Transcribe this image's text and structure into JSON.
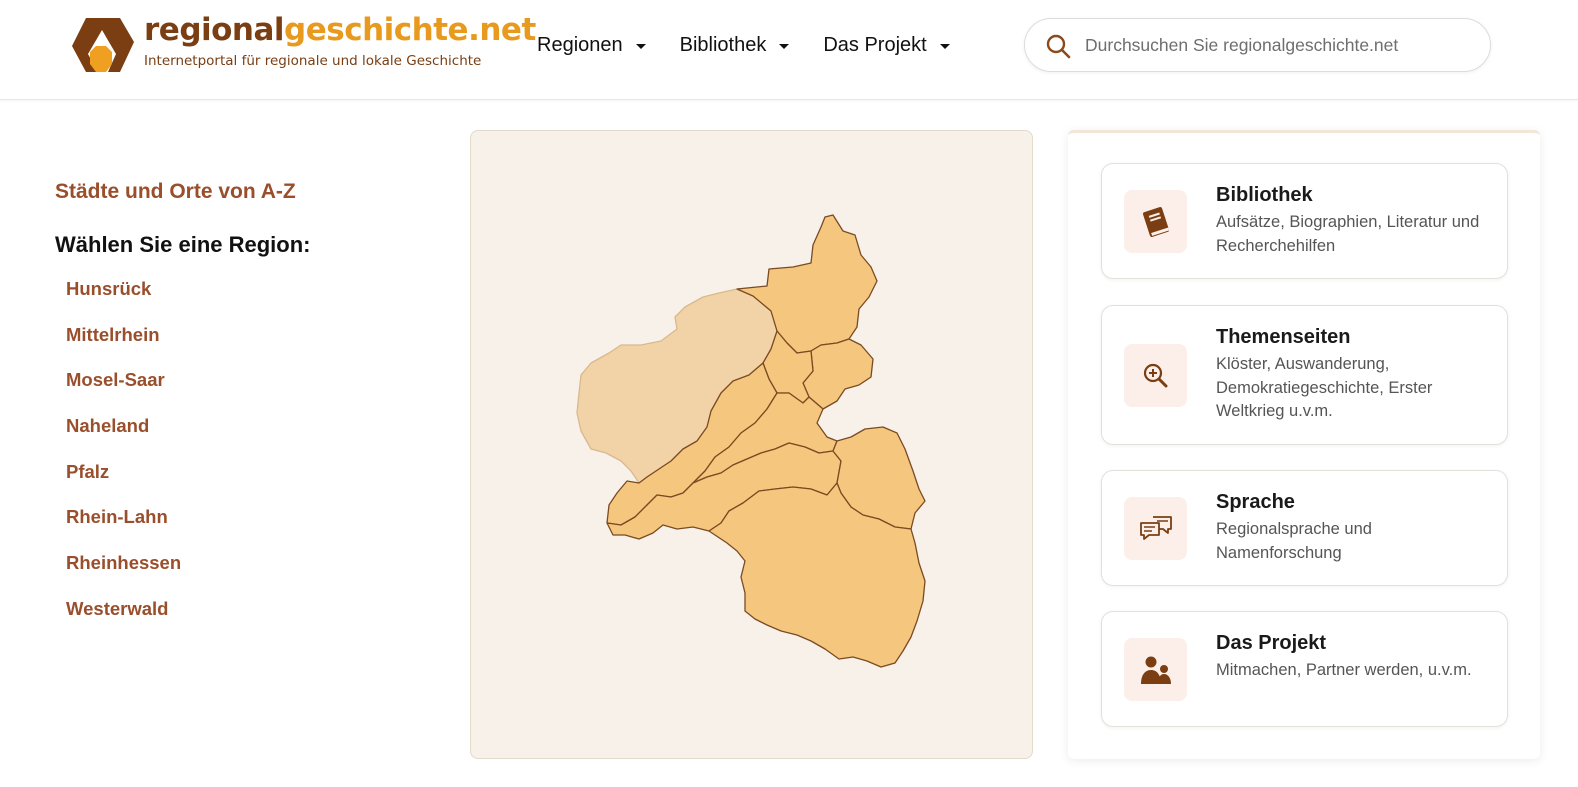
{
  "header": {
    "logo_title_part1": "regional",
    "logo_title_part2": "geschichte.net",
    "logo_subtitle": "Internetportal für regionale und lokale Geschichte",
    "nav": [
      {
        "label": "Regionen"
      },
      {
        "label": "Bibliothek"
      },
      {
        "label": "Das Projekt"
      }
    ],
    "search_placeholder": "Durchsuchen Sie regionalgeschichte.net"
  },
  "left": {
    "az_link": "Städte und Orte von A-Z",
    "choose_heading": "Wählen Sie eine Region:",
    "regions": [
      "Hunsrück",
      "Mittelrhein",
      "Mosel-Saar",
      "Naheland",
      "Pfalz",
      "Rhein-Lahn",
      "Rheinhessen",
      "Westerwald"
    ]
  },
  "cards": [
    {
      "title": "Bibliothek",
      "desc": "Aufsätze, Biographien, Literatur und Recherchehilfen",
      "icon": "book-icon"
    },
    {
      "title": "Themenseiten",
      "desc": "Klöster, Auswanderung, Demokratiegeschichte, Erster Weltkrieg u.v.m.",
      "icon": "magnifier-plus-icon"
    },
    {
      "title": "Sprache",
      "desc": "Regionalsprache und Namenforschung",
      "icon": "speech-bubbles-icon"
    },
    {
      "title": "Das Projekt",
      "desc": "Mitmachen, Partner werden, u.v.m.",
      "icon": "people-icon"
    }
  ],
  "colors": {
    "brand_brown": "#7a3e12",
    "brand_orange": "#e89a1e",
    "link_brown": "#9a4f2c",
    "map_region": "#f5c77e",
    "map_region_faded": "#f1d3a7",
    "map_stroke": "#7a4a22"
  }
}
